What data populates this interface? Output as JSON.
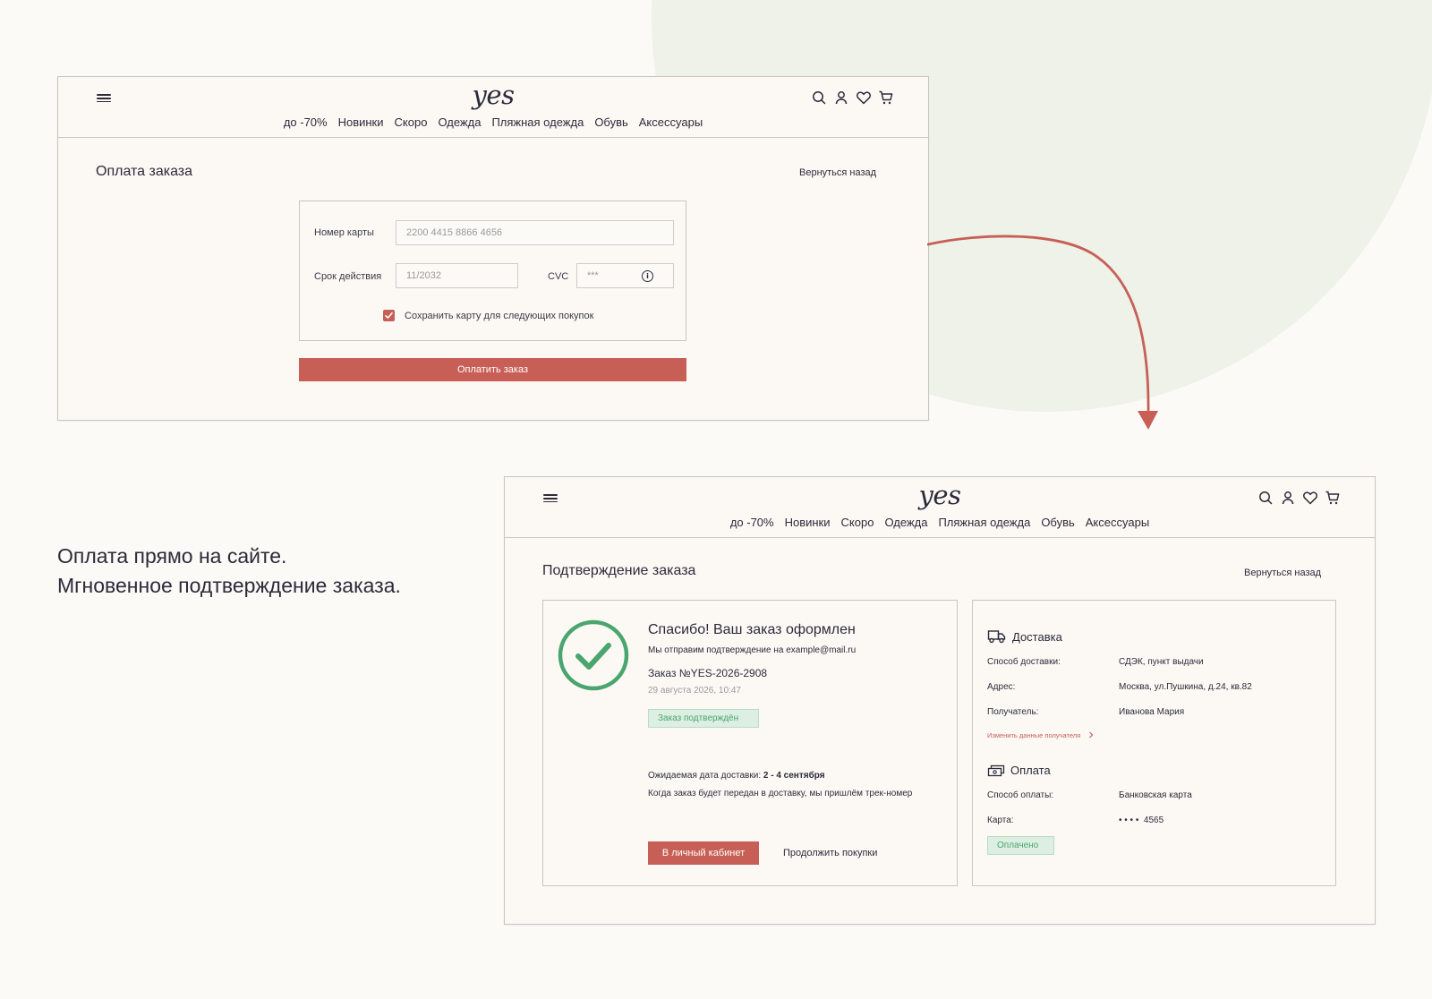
{
  "tagline": {
    "line1": "Оплата прямо на сайте.",
    "line2": "Мгновенное подтверждение заказа."
  },
  "header": {
    "logo": "yes",
    "nav": [
      "до -70%",
      "Новинки",
      "Скоро",
      "Одежда",
      "Пляжная одежда",
      "Обувь",
      "Аксессуары"
    ],
    "icons": [
      "search-icon",
      "user-icon",
      "heart-icon",
      "cart-icon"
    ]
  },
  "payment": {
    "title": "Оплата заказа",
    "back_link": "Вернуться назад",
    "card_number_label": "Номер карты",
    "card_number_value": "2200 4415 8866 4656",
    "expiry_label": "Срок действия",
    "expiry_value": "11/2032",
    "cvc_label": "CVC",
    "cvc_value": "***",
    "save_card_label": "Сохранить карту для следующих покупок",
    "save_card_checked": true,
    "pay_button": "Оплатить заказ"
  },
  "confirmation": {
    "title": "Подтверждение заказа",
    "back_link": "Вернуться назад",
    "success_title": "Спасибо! Ваш заказ оформлен",
    "email_note": "Мы отправим подтверждение на example@mail.ru",
    "order_number": "Заказ №YES-2026-2908",
    "order_date": "29 августа 2026, 10:47",
    "status_badge": "Заказ подтверждён",
    "delivery_date_label": "Ожидаемая дата доставки:",
    "delivery_date_value": "2 - 4 сентября",
    "tracking_note": "Когда заказ будет передан в доставку, мы пришлём трек-номер",
    "account_button": "В личный кабинет",
    "continue_link": "Продолжить покупки",
    "delivery": {
      "title": "Доставка",
      "method_label": "Способ доставки:",
      "method_value": "СДЭК, пункт выдачи",
      "address_label": "Адрес:",
      "address_value": "Москва, ул.Пушкина, д.24, кв.82",
      "recipient_label": "Получатель:",
      "recipient_value": "Иванова Мария",
      "edit_link": "Изменить данные получателя"
    },
    "payment": {
      "title": "Оплата",
      "method_label": "Способ оплаты:",
      "method_value": "Банковская карта",
      "card_label": "Карта:",
      "card_value": "• • • •  4565",
      "status_badge": "Оплачено"
    }
  },
  "colors": {
    "accent": "#c75f56",
    "success": "#4aa56e",
    "background": "#fcfaf7",
    "text": "#2b2b3a"
  }
}
